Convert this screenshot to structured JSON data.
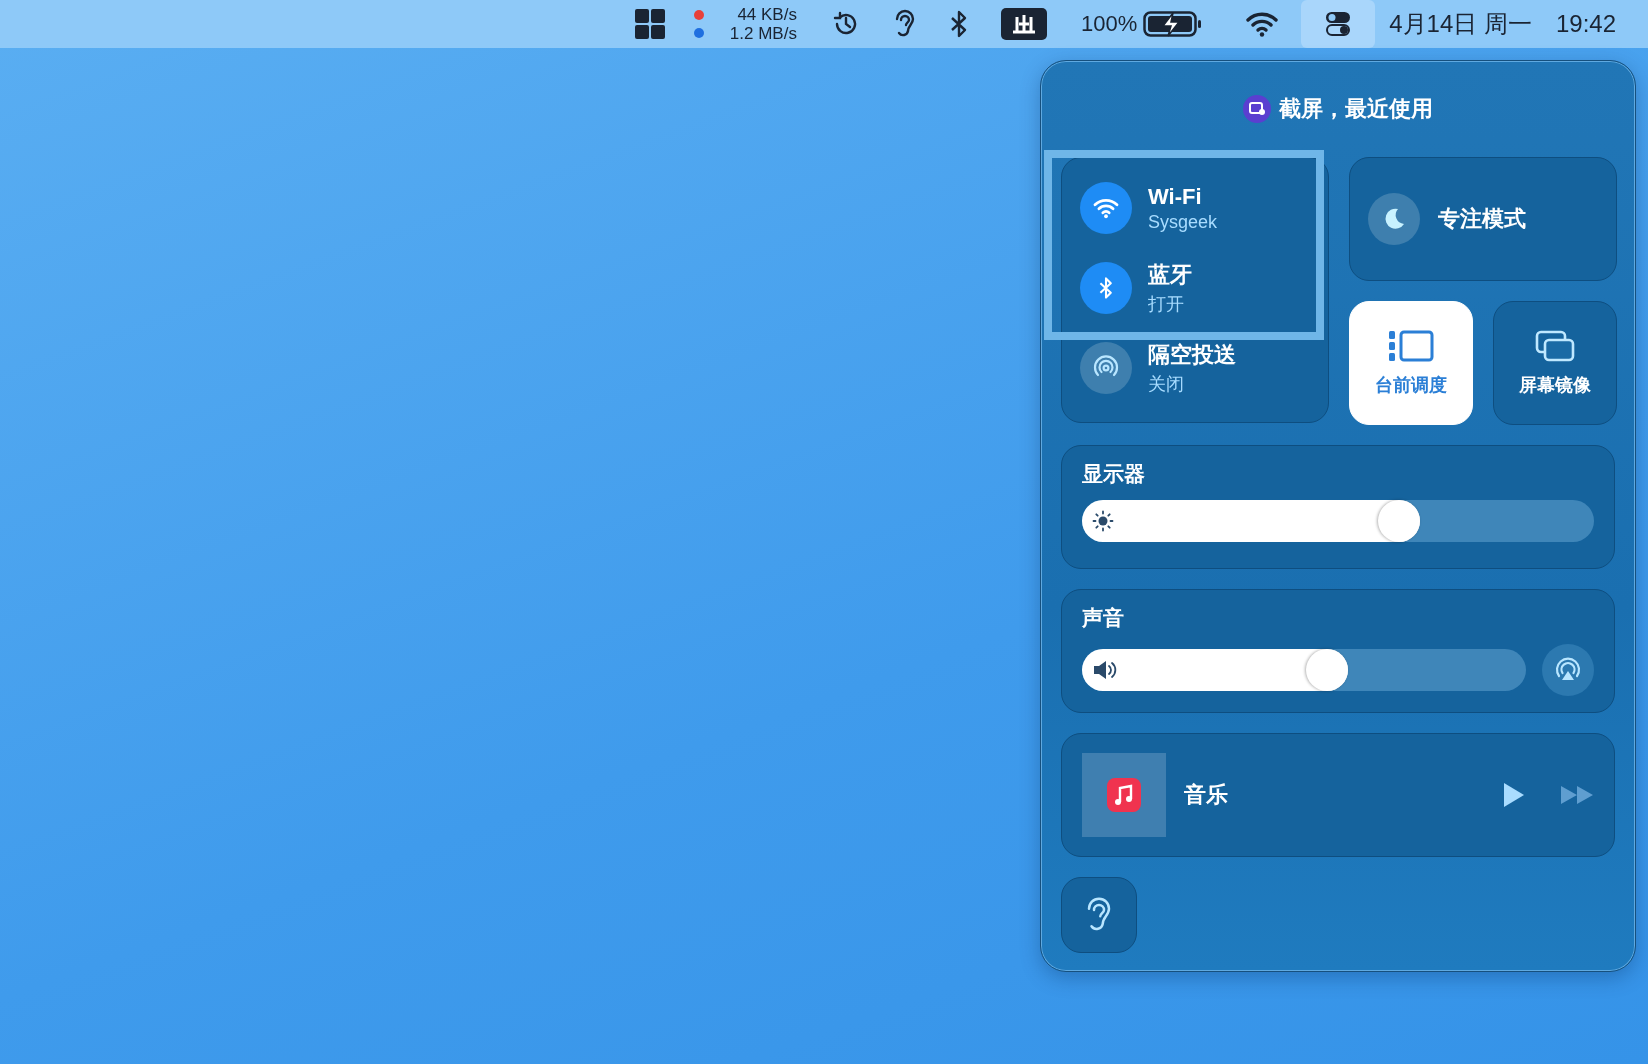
{
  "menu_bar": {
    "network": {
      "upload": "44 KB/s",
      "download": "1.2 MB/s"
    },
    "battery": {
      "percent": "100%",
      "charging": true
    },
    "control_center_selected": true,
    "date": "4月14日 周一",
    "time": "19:42"
  },
  "control_center": {
    "recent_use": "截屏，最近使用",
    "connectivity": {
      "focus_ring": true,
      "items": [
        {
          "kind": "wifi",
          "title": "Wi-Fi",
          "subtitle": "Sysgeek",
          "on": true
        },
        {
          "kind": "bluetooth",
          "title": "蓝牙",
          "subtitle": "打开",
          "on": true
        },
        {
          "kind": "airdrop",
          "title": "隔空投送",
          "subtitle": "关闭",
          "on": false
        }
      ]
    },
    "focus": {
      "label": "专注模式",
      "on": false
    },
    "toggles": [
      {
        "kind": "stage",
        "label": "台前调度",
        "on": true
      },
      {
        "kind": "mirror",
        "label": "屏幕镜像",
        "on": false
      }
    ],
    "display": {
      "title": "显示器",
      "level": 0.66
    },
    "sound": {
      "title": "声音",
      "level": 0.6
    },
    "now_playing": {
      "app": "音乐"
    }
  }
}
